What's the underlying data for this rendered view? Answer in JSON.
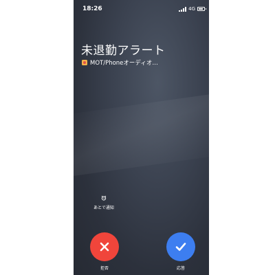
{
  "status_bar": {
    "time": "18:26",
    "network": "4G",
    "battery_level": 0.8
  },
  "alert": {
    "title": "未退勤アラート",
    "app_name": "MOT/Phoneオーディオ…"
  },
  "remind_later": {
    "icon": "alarm-clock-icon",
    "label": "あとで通知"
  },
  "actions": {
    "decline_label": "拒否",
    "accept_label": "応答",
    "decline_color": "#f0453b",
    "accept_color": "#3d7ef0"
  }
}
